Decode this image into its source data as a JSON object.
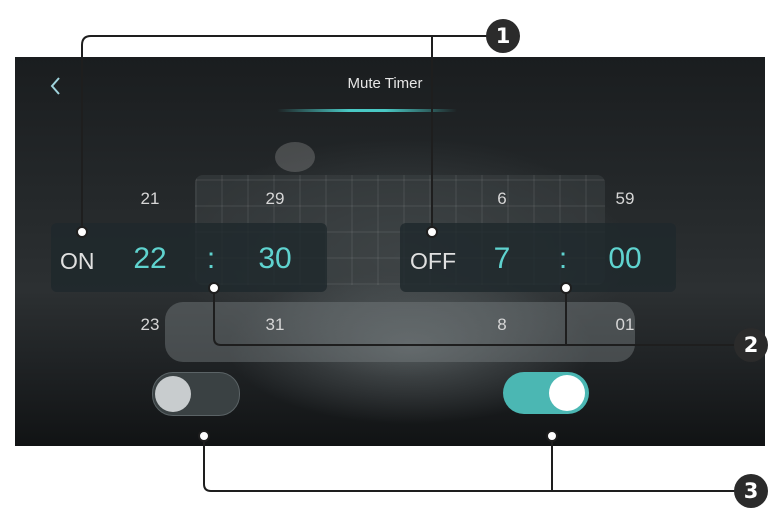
{
  "screen": {
    "title": "Mute Timer",
    "back_icon": "chevron-left-icon"
  },
  "on_timer": {
    "label": "ON",
    "hour": "22",
    "separator": ":",
    "minute": "30",
    "hour_prev": "21",
    "hour_next": "23",
    "minute_prev": "29",
    "minute_next": "31"
  },
  "off_timer": {
    "label": "OFF",
    "hour": "7",
    "separator": ":",
    "minute": "00",
    "hour_prev": "6",
    "hour_next": "8",
    "minute_prev": "59",
    "minute_next": "01"
  },
  "toggles": {
    "on_timer_enabled": false,
    "off_timer_enabled": true
  },
  "callouts": [
    "1",
    "2",
    "3"
  ],
  "colors": {
    "accent": "#4bb7b3",
    "digit": "#5fd3cf",
    "badge": "#2b2b2b"
  }
}
